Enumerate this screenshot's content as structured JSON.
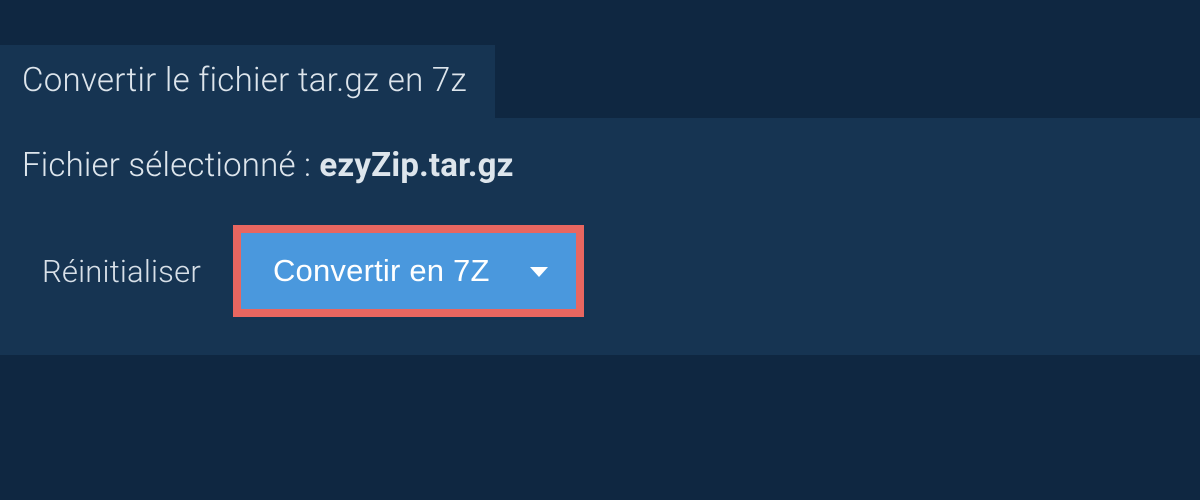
{
  "title": "Convertir le fichier tar.gz en 7z",
  "fileSelected": {
    "label": "Fichier sélectionné : ",
    "filename": "ezyZip.tar.gz"
  },
  "buttons": {
    "reset": "Réinitialiser",
    "convert": "Convertir en 7Z"
  }
}
